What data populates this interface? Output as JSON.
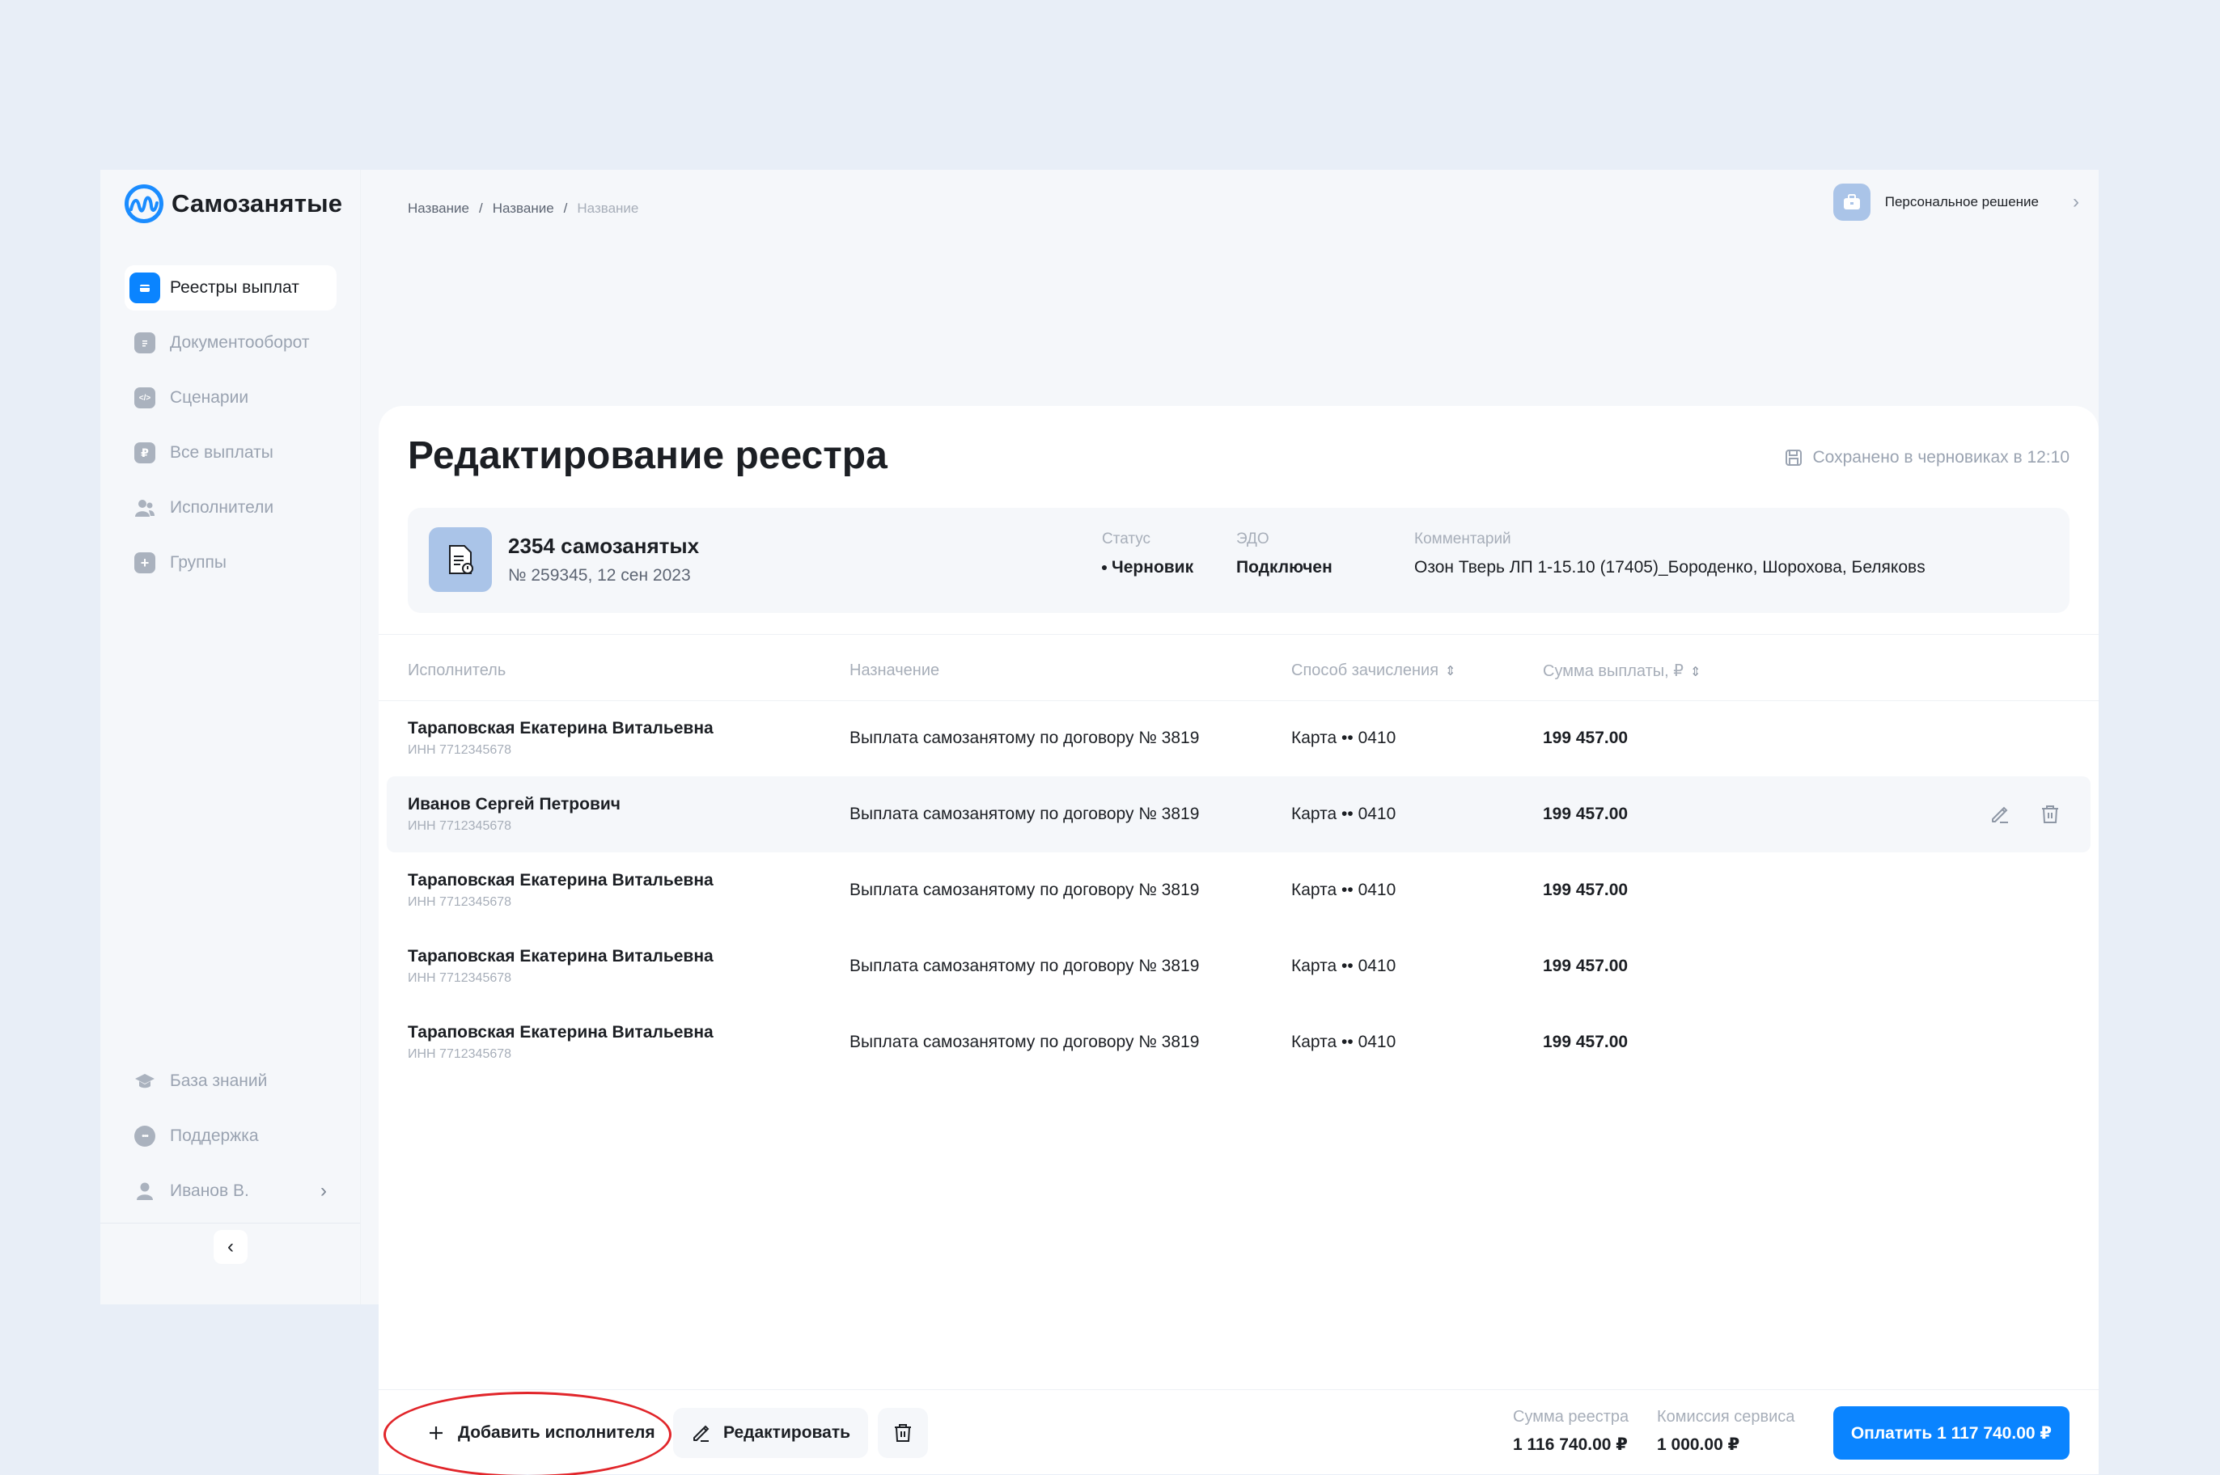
{
  "app": {
    "brand": "Самозанятые",
    "colors": {
      "accent": "#0a84ff",
      "highlight": "#e1252a"
    }
  },
  "sidebar": {
    "items": [
      {
        "label": "Реестры выплат",
        "icon": "wallet-icon",
        "active": true
      },
      {
        "label": "Документооборот",
        "icon": "document-icon"
      },
      {
        "label": "Сценарии",
        "icon": "code-icon"
      },
      {
        "label": "Все выплаты",
        "icon": "ruble-icon"
      },
      {
        "label": "Исполнители",
        "icon": "users-icon"
      },
      {
        "label": "Группы",
        "icon": "folder-plus-icon"
      }
    ],
    "bottom": [
      {
        "label": "База знаний",
        "icon": "graduation-cap-icon"
      },
      {
        "label": "Поддержка",
        "icon": "chat-icon"
      },
      {
        "label": "Иванов В.",
        "icon": "user-icon"
      }
    ]
  },
  "breadcrumb": [
    "Название",
    "Название",
    "Название"
  ],
  "persona": {
    "label": "Персональное решение"
  },
  "page": {
    "title": "Редактирование реестра",
    "saved_status": "Сохранено в черновиках в 12:10"
  },
  "registry": {
    "title": "2354 самозанятых",
    "subtitle": "№ 259345, 12 сен 2023",
    "status_label": "Статус",
    "status_value": "Черновик",
    "edo_label": "ЭДО",
    "edo_value": "Подключен",
    "comment_label": "Комментарий",
    "comment_value": "Озон Тверь ЛП 1-15.10 (17405)_Бороденко, Шорохова, Беляковs"
  },
  "table": {
    "columns": [
      "Исполнитель",
      "Назначение",
      "Способ зачисления",
      "Сумма выплаты, ₽"
    ],
    "rows": [
      {
        "name": "Тараповская Екатерина Витальевна",
        "inn": "ИНН 7712345678",
        "purpose": "Выплата самозанятому по договору № 3819",
        "method": "Карта •• 0410",
        "amount": "199 457.00"
      },
      {
        "name": "Иванов Сергей Петрович",
        "inn": "ИНН 7712345678",
        "purpose": "Выплата самозанятому по договору № 3819",
        "method": "Карта •• 0410",
        "amount": "199 457.00"
      },
      {
        "name": "Тараповская Екатерина Витальевна",
        "inn": "ИНН 7712345678",
        "purpose": "Выплата самозанятому по договору № 3819",
        "method": "Карта •• 0410",
        "amount": "199 457.00"
      },
      {
        "name": "Тараповская Екатерина Витальевна",
        "inn": "ИНН 7712345678",
        "purpose": "Выплата самозанятому по договору № 3819",
        "method": "Карта •• 0410",
        "amount": "199 457.00"
      },
      {
        "name": "Тараповская Екатерина Витальевна",
        "inn": "ИНН 7712345678",
        "purpose": "Выплата самозанятому по договору № 3819",
        "method": "Карта •• 0410",
        "amount": "199 457.00"
      }
    ]
  },
  "footer": {
    "add_label": "Добавить исполнителя",
    "edit_label": "Редактировать",
    "sum_label": "Сумма реестра",
    "sum_value": "1 116 740.00 ₽",
    "fee_label": "Комиссия сервиса",
    "fee_value": "1 000.00 ₽",
    "pay_label": "Оплатить 1 117 740.00 ₽"
  }
}
